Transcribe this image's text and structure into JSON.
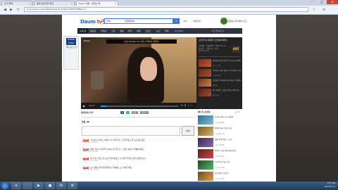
{
  "browser": {
    "tabs": [
      {
        "label": "오디 위헤"
      },
      {
        "label": "동영 전실거울 확인"
      },
      {
        "label": "Daum 위헤 - 동영상 채"
      }
    ],
    "url": "tvpot.daum.net/clip/ClipView.do?clipid=45557328&lu=z",
    "window_controls": [
      "─",
      "□",
      "✕"
    ]
  },
  "header": {
    "logo_daum": "Daum",
    "logo_tv": "tv팟",
    "search_scope": "전체",
    "search_value": "전진동잉앤",
    "search_button": "검색",
    "links": [
      "검색",
      "회원정보"
    ],
    "user_name": "동정보 관리센터 로그"
  },
  "gnb": {
    "items": [
      "tv팟 홈",
      "동영상",
      "라이브",
      "스타",
      "방송",
      "뮤직",
      "게임",
      "스포츠",
      "뉴스",
      "테마",
      "tv팟 분석"
    ],
    "right_label": "tv팟 플레이어"
  },
  "ad": {
    "badge": "SUPER STAR",
    "text": "배너 광고 문구"
  },
  "player": {
    "watermark": "Daum",
    "caption_prefix": "인성",
    "caption_main": "SWING UP 이제 시작해서 줄였당",
    "time": "00:37",
    "progress": 0.08,
    "icons": [
      "HD",
      "♪",
      "⛶"
    ]
  },
  "info": {
    "title": "오민석 의 대피학 간인상의 배려..",
    "meta": [
      "15개월 • 방송연예 • 2013.11.11",
      "마마미 • 오영선 2 • 클립",
      "2013.11.11"
    ],
    "number": "495",
    "related": [
      {
        "title": "[tvN] 인기인 정수 바 보기로 준비해도",
        "sub": "오 후 3:00"
      },
      {
        "title": "오마이고 같이 없어도 나이 같이 보기",
        "sub": "드라마 2회"
      },
      {
        "title": "오영심 인 이사람 살 를 새로 시작하는",
        "sub": "비주얼"
      },
      {
        "title": "이 다이어트 요정 보여 뜻 밖에 시도",
        "sub": "최신클립"
      }
    ]
  },
  "tools": {
    "title": "재생목록 추가",
    "share": [
      "f",
      "t",
      "공유",
      "퍼가기"
    ]
  },
  "comments": {
    "title": "댓글 (0)",
    "submit": "등록",
    "items": [
      {
        "badge": "BEST",
        "text": "가사인지 아직도 이해가 전 이렇게 안 그렇게 해도 잘 모르겠는데요",
        "meta": "2013.11.11 08:21"
      },
      {
        "badge": "BEST",
        "text": "예쁘 어딘가 어울려 보이는 돈 입는거 그 옷은 점점 더 예뻐지네요",
        "meta": "2013.11.11 09:03"
      },
      {
        "badge": "NEW",
        "text": "지금 여기 있는 옷 보면 엄청 예쁘고 저 정말 좋아요 많이 응원합니다",
        "meta": "2013.11.12 10:15"
      },
      {
        "badge": "NEW",
        "text": "오늘 방송 진짜 재밌었어요 다음에도 또 나와주세요",
        "meta": "2013.11.12 11:40"
      }
    ]
  },
  "best": {
    "title": "베스트 동영상",
    "more": "더보기 ›",
    "items": [
      {
        "title": "동남아 최대 규모 쇼핑몰",
        "sub": "조회 96,345",
        "color1": "#2f6f8e",
        "color2": "#7fc0d8"
      },
      {
        "title": "세계의 숨은 비경 모음",
        "sub": "조회 84,110",
        "color1": "#7a5a2a",
        "color2": "#d8b46a"
      },
      {
        "title": "배틀 인생 레전드 모음",
        "sub": "조회 73,902",
        "color1": "#3a2a4a",
        "color2": "#8a6aa8"
      },
      {
        "title": "아이돌 무대 직캠 하이라이트",
        "sub": "조회 65,287",
        "color1": "#5a1e1e",
        "color2": "#c84a4a"
      },
      {
        "title": "오늘의 핫 이슈 모음",
        "sub": "조회 52,018",
        "color1": "#1e4a2a",
        "color2": "#5ab46a"
      },
      {
        "title": "맛집 탐방 특집 편",
        "sub": "조회 41,776",
        "color1": "#6a4a1e",
        "color2": "#e0a050"
      }
    ]
  },
  "taskbar": {
    "apps": [
      "e",
      "🗀",
      "▶",
      "●",
      "✉",
      "⚙"
    ],
    "clock_time": "오후 3:29",
    "clock_date": "2013-11-11"
  }
}
